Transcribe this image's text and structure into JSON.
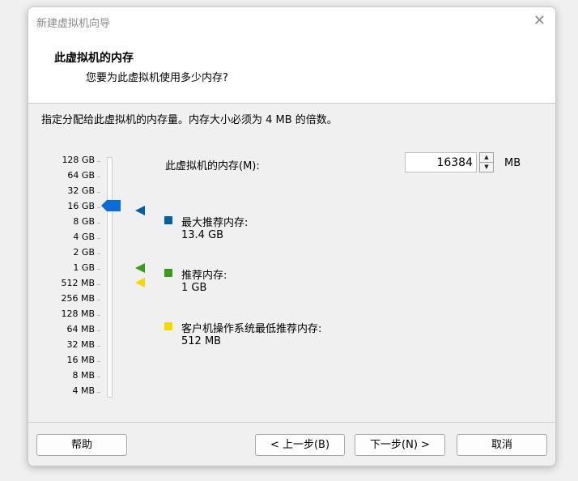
{
  "window": {
    "title": "新建虚拟机向导",
    "close_glyph": "✕"
  },
  "header": {
    "title": "此虚拟机的内存",
    "subtitle": "您要为此虚拟机使用多少内存?"
  },
  "description": "指定分配给此虚拟机的内存量。内存大小必须为 4 MB 的倍数。",
  "memory": {
    "label": "此虚拟机的内存(M):",
    "value": "16384",
    "unit": "MB",
    "spin_up": "▲",
    "spin_down": "▼"
  },
  "scale": {
    "ticks": [
      "128 GB",
      "64 GB",
      "32 GB",
      "16 GB",
      "8 GB",
      "4 GB",
      "2 GB",
      "1 GB",
      "512 MB",
      "256 MB",
      "128 MB",
      "64 MB",
      "32 MB",
      "16 MB",
      "8 MB",
      "4 MB"
    ],
    "selected": "16 GB"
  },
  "legend": [
    {
      "label": "最大推荐内存:",
      "value": "13.4 GB",
      "color": "#005fa8"
    },
    {
      "label": "推荐内存:",
      "value": "1 GB",
      "color": "#3a9a1c"
    },
    {
      "label": "客户机操作系统最低推荐内存:",
      "value": "512 MB",
      "color": "#f5d800"
    }
  ],
  "buttons": {
    "help": "帮助",
    "back": "< 上一步(B)",
    "next": "下一步(N) >",
    "cancel": "取消"
  },
  "colors": {
    "thumb": "#0a6cd6"
  }
}
